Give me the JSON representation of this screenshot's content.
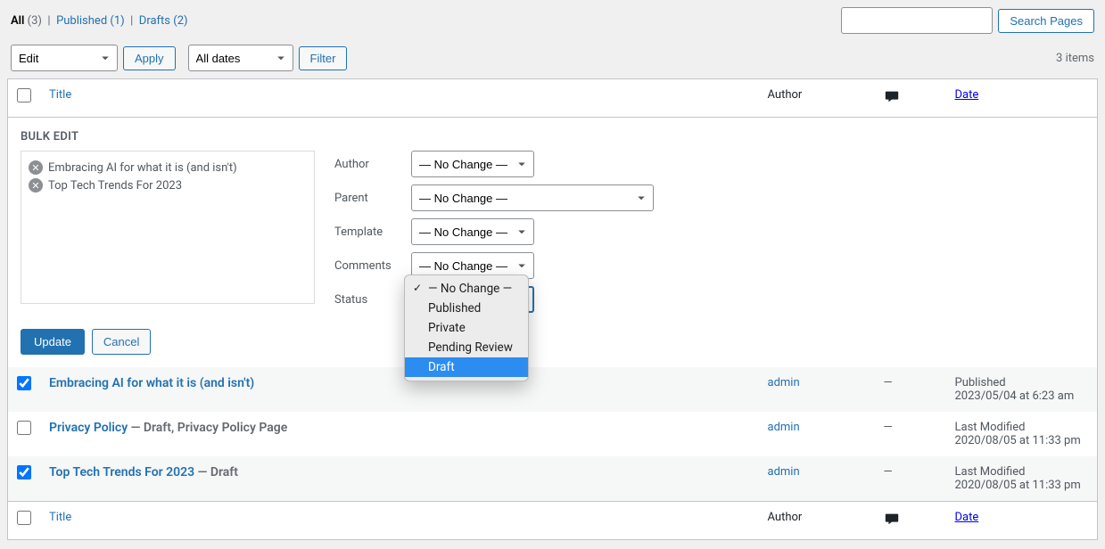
{
  "filters": {
    "all_label": "All",
    "all_count": "(3)",
    "published_label": "Published",
    "published_count": "(1)",
    "drafts_label": "Drafts",
    "drafts_count": "(2)",
    "sep": "|"
  },
  "search": {
    "button": "Search Pages"
  },
  "actions": {
    "bulk_selected": "Edit",
    "apply": "Apply",
    "date_selected": "All dates",
    "filter": "Filter",
    "items_count": "3 items"
  },
  "columns": {
    "title": "Title",
    "author": "Author",
    "date": "Date"
  },
  "bulk_edit": {
    "header": "BULK EDIT",
    "items": [
      "Embracing AI for what it is (and isn't)",
      "Top Tech Trends For 2023"
    ],
    "labels": {
      "author": "Author",
      "parent": "Parent",
      "template": "Template",
      "comments": "Comments",
      "status": "Status"
    },
    "no_change": "— No Change —",
    "status_options": [
      "— No Change —",
      "Published",
      "Private",
      "Pending Review",
      "Draft"
    ],
    "update": "Update",
    "cancel": "Cancel"
  },
  "rows": [
    {
      "checked": true,
      "title": "Embracing AI for what it is (and isn't)",
      "suffix": "",
      "author": "admin",
      "comments": "—",
      "date_label": "Published",
      "date_value": "2023/05/04 at 6:23 am",
      "alt": true
    },
    {
      "checked": false,
      "title": "Privacy Policy",
      "suffix": " — Draft, Privacy Policy Page",
      "author": "admin",
      "comments": "—",
      "date_label": "Last Modified",
      "date_value": "2020/08/05 at 11:33 pm",
      "alt": false
    },
    {
      "checked": true,
      "title": "Top Tech Trends For 2023",
      "suffix": " — Draft",
      "author": "admin",
      "comments": "—",
      "date_label": "Last Modified",
      "date_value": "2020/08/05 at 11:33 pm",
      "alt": true
    }
  ]
}
